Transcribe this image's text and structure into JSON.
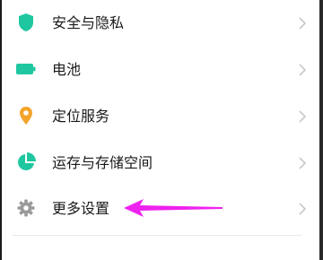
{
  "settings": {
    "items": [
      {
        "label": "安全与隐私",
        "icon": "shield-icon"
      },
      {
        "label": "电池",
        "icon": "battery-icon"
      },
      {
        "label": "定位服务",
        "icon": "location-pin-icon"
      },
      {
        "label": "运存与存储空间",
        "icon": "pie-chart-icon"
      },
      {
        "label": "更多设置",
        "icon": "gear-icon"
      }
    ]
  },
  "colors": {
    "accent_green": "#1fc7a0",
    "location_orange": "#f4a42c",
    "gear_gray": "#9a9a9a",
    "annotation_arrow": "#ee22ee",
    "chevron_gray": "#c8c8c8"
  }
}
